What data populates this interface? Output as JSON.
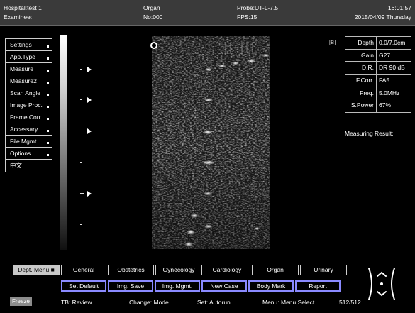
{
  "header": {
    "hospital": "Hospital:test 1",
    "examinee": "Examinee:",
    "organ_label": "Organ",
    "organ_no": "No:000",
    "probe": "Probe:UT-L-7.5",
    "fps": "FPS:15",
    "time": "16:01:57",
    "date": "2015/04/09 Thursday"
  },
  "menu": {
    "items": [
      {
        "label": "Settings"
      },
      {
        "label": "App.Type"
      },
      {
        "label": "Measure"
      },
      {
        "label": "Measure2"
      },
      {
        "label": "Scan Angle"
      },
      {
        "label": "Image Proc."
      },
      {
        "label": "Frame Corr."
      },
      {
        "label": "Accessary"
      },
      {
        "label": "File Mgmt."
      },
      {
        "label": "Options"
      },
      {
        "label": "中文"
      }
    ]
  },
  "mode_tag": "[B]",
  "params": [
    {
      "label": "Depth",
      "value": "0.0/7.0cm"
    },
    {
      "label": "Gain",
      "value": "G27"
    },
    {
      "label": "D.R.",
      "value": "DR 90 dB"
    },
    {
      "label": "F.Corr.",
      "value": "FA5"
    },
    {
      "label": "Freq.",
      "value": "5.0MHz"
    },
    {
      "label": "S.Power",
      "value": "67%"
    }
  ],
  "measuring_result": "Measuring Result:",
  "tabs": [
    {
      "label": "Dept. Menu"
    },
    {
      "label": "General"
    },
    {
      "label": "Obstetrics"
    },
    {
      "label": "Gynecology"
    },
    {
      "label": "Cardiology"
    },
    {
      "label": "Organ"
    },
    {
      "label": "Urinary"
    }
  ],
  "functions": [
    {
      "label": "Set Default"
    },
    {
      "label": "Img. Save"
    },
    {
      "label": "Img. Mgmt."
    },
    {
      "label": "New Case"
    },
    {
      "label": "Body Mark"
    },
    {
      "label": "Report"
    }
  ],
  "status": {
    "freeze": "Freeze",
    "tb": "TB: Review",
    "change": "Change: Mode",
    "set": "Set: Autorun",
    "menu": "Menu: Menu Select",
    "frames": "512/512"
  },
  "colors": {
    "header_bg": "#3a3a3a",
    "function_border": "#8a8aff",
    "active_tab": "#c8c8c8"
  }
}
